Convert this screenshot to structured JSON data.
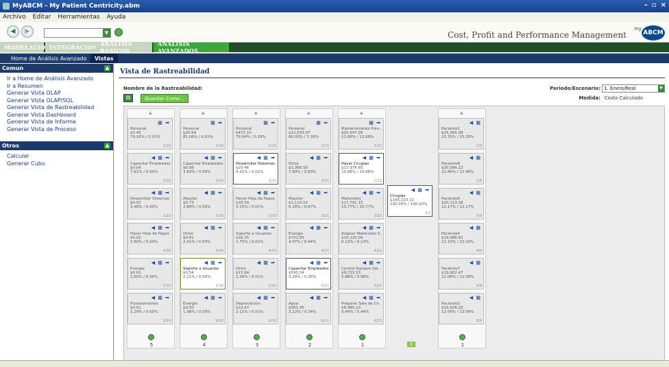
{
  "window": {
    "title": "MyABCM - My Patient Centricity.abm"
  },
  "menu": [
    "Archivo",
    "Editar",
    "Herramientas",
    "Ayuda"
  ],
  "brand": "Cost, Profit and Performance Management",
  "logo": {
    "my": "my",
    "abc": "ABCM"
  },
  "tabs": [
    "MODELACIÓN",
    "INTEGRACIÓN",
    "ANÁLISIS BÁSICOS",
    "ANÁLISIS AVANZADOS"
  ],
  "subtabs": [
    "Home de Análisis Avanzado",
    "Vistas"
  ],
  "sidebar": {
    "comun_title": "Comun",
    "comun_items": [
      "Ir a Home de Análisis Avanzado",
      "Ir a Resumen",
      "Generar Vista OLAP",
      "Generar Vista OLAP/SQL",
      "Generar Vista de Rastreabilidad",
      "Generar Vista Dashboard",
      "Generar Vista de Informe",
      "Generar Vista de Proceso"
    ],
    "otros_title": "Otros",
    "otros_items": [
      "Calcular",
      "Generar Cubo"
    ]
  },
  "main": {
    "title": "Vista de Rastreabilidad",
    "nombre_label": "Nombre de la Rastreabilidad:",
    "save_label": "Guardar Como...",
    "periodo_label": "Periodo/Escenario:",
    "periodo_value": "1. Enero/Real",
    "medida_label": "Medida:",
    "medida_value": "Costo Calculado"
  },
  "columns": [
    {
      "num": "5",
      "nodes": [
        {
          "name": "Personal",
          "value": "$0.45",
          "pct": "79.16% / 0.01%",
          "idx": "1/10"
        },
        {
          "name": "Capacitar Empleados",
          "value": "$0.04",
          "pct": "7.61% / 0.00%",
          "idx": "2/10"
        },
        {
          "name": "Desarrollar Sistemas",
          "value": "$0.02",
          "pct": "3.48% / 0.00%",
          "idx": "3/10"
        },
        {
          "name": "Hacer Hoja de Pagos",
          "value": "$0.02",
          "pct": "2.80% / 0.00%",
          "idx": "4/10"
        },
        {
          "name": "Energía",
          "value": "$0.01",
          "pct": "2.50% / 0.00%",
          "idx": "5/10"
        },
        {
          "name": "Procesamiento",
          "value": "$0.01",
          "pct": "2.29% / 0.00%",
          "idx": "6/10"
        }
      ]
    },
    {
      "num": "4",
      "nodes": [
        {
          "name": "Personal",
          "value": "$20.64",
          "pct": "81.06% / 0.01%",
          "idx": "1/10"
        },
        {
          "name": "Capacitar Empleados",
          "value": "$0.98",
          "pct": "3.83% / 0.00%",
          "idx": "2/10"
        },
        {
          "name": "Alquiler",
          "value": "$0.73",
          "pct": "2.89% / 0.00%",
          "idx": "3/10"
        },
        {
          "name": "Otros",
          "value": "$0.61",
          "pct": "2.41% / 0.00%",
          "idx": "4/10"
        },
        {
          "name": "Soporte a Usuarios",
          "value": "$0.54",
          "pct": "2.11% / 0.00%",
          "idx": "5/10"
        },
        {
          "name": "Energía",
          "value": "$0.50",
          "pct": "1.98% / 0.00%",
          "idx": "6/10"
        }
      ]
    },
    {
      "num": "3",
      "nodes": [
        {
          "name": "Personal",
          "value": "$472.10",
          "pct": "79.94% / 0.29%",
          "idx": "1/10"
        },
        {
          "name": "Desarrollar Sistemas",
          "value": "$25.46",
          "pct": "4.31% / 0.02%",
          "idx": "2/10"
        },
        {
          "name": "Hacer Hoja de Pagos",
          "value": "$18.59",
          "pct": "3.15% / 0.01%",
          "idx": "3/10"
        },
        {
          "name": "Soporte a Usuarios",
          "value": "$16.25",
          "pct": "2.75% / 0.01%",
          "idx": "4/10"
        },
        {
          "name": "Otros",
          "value": "$13.94",
          "pct": "2.36% / 0.01%",
          "idx": "5/10"
        },
        {
          "name": "Depreciación",
          "value": "$12.47",
          "pct": "2.11% / 0.01%",
          "idx": "6/10"
        }
      ]
    },
    {
      "num": "2",
      "nodes": [
        {
          "name": "Personal",
          "value": "$12,033.07",
          "pct": "66.93% / 7.28%",
          "idx": "1/11"
        },
        {
          "name": "Otros",
          "value": "$1,366.55",
          "pct": "7.60% / 0.83%",
          "idx": "2/11"
        },
        {
          "name": "Alquiler",
          "value": "$1,110.53",
          "pct": "6.18% / 0.67%",
          "idx": "3/11"
        },
        {
          "name": "Energía",
          "value": "$731.83",
          "pct": "4.07% / 0.44%",
          "idx": "4/11"
        },
        {
          "name": "Capacitar Empleados",
          "value": "$590.54",
          "pct": "3.28% / 0.36%",
          "idx": "5/11"
        },
        {
          "name": "Agua",
          "value": "$561.45",
          "pct": "3.12% / 0.34%",
          "idx": "6/11"
        }
      ]
    },
    {
      "num": "1",
      "nodes": [
        {
          "name": "Mantenimiento Prev...",
          "value": "$20,947.99",
          "pct": "12.68% / 12.68%",
          "idx": "1/22"
        },
        {
          "name": "Hacer Cirugías",
          "value": "$17,978.65",
          "pct": "10.88% / 10.88%",
          "idx": "2/22"
        },
        {
          "name": "Materiales",
          "value": "$17,791.15",
          "pct": "10.77% / 10.77%",
          "idx": "3/22"
        },
        {
          "name": "Asignar Materiales S...",
          "value": "$10,120.04",
          "pct": "6.13% / 6.13%",
          "idx": "4/22"
        },
        {
          "name": "Control Equipos Sal...",
          "value": "$9,721.53",
          "pct": "5.88% / 5.88%",
          "idx": "5/22"
        },
        {
          "name": "Preparar Sala de Cir...",
          "value": "$8,985.10",
          "pct": "5.44% / 5.44%",
          "idx": "6/22"
        }
      ]
    },
    {
      "num": "1",
      "nodes": [
        {
          "name": "Paciente1",
          "value": "$25,365.08",
          "pct": "15.35% / 15.35%",
          "idx": "1/9"
        },
        {
          "name": "Paciente8",
          "value": "$20,584.22",
          "pct": "12.46% / 12.46%",
          "idx": "2/9"
        },
        {
          "name": "Paciente6",
          "value": "$20,113.38",
          "pct": "12.17% / 12.17%",
          "idx": "3/9"
        },
        {
          "name": "Paciente4",
          "value": "$19,986.62",
          "pct": "12.10% / 12.10%",
          "idx": "4/9"
        },
        {
          "name": "Paciente7",
          "value": "$19,962.47",
          "pct": "12.08% / 12.08%",
          "idx": "5/9"
        },
        {
          "name": "Paciente2",
          "value": "$19,926.25",
          "pct": "12.06% / 12.06%",
          "idx": "6/9"
        }
      ]
    }
  ],
  "center": {
    "name": "Cirugías",
    "value": "$165,223.11",
    "pct": "100.00% / 100.00%",
    "idx": "1/1",
    "num": "0"
  },
  "icons": {
    "left": "arrow-left-icon",
    "cube": "cube-icon",
    "right": "arrow-right-icon"
  },
  "colors": {
    "accent": "#3aa93a",
    "navy": "#1c3a6a"
  }
}
